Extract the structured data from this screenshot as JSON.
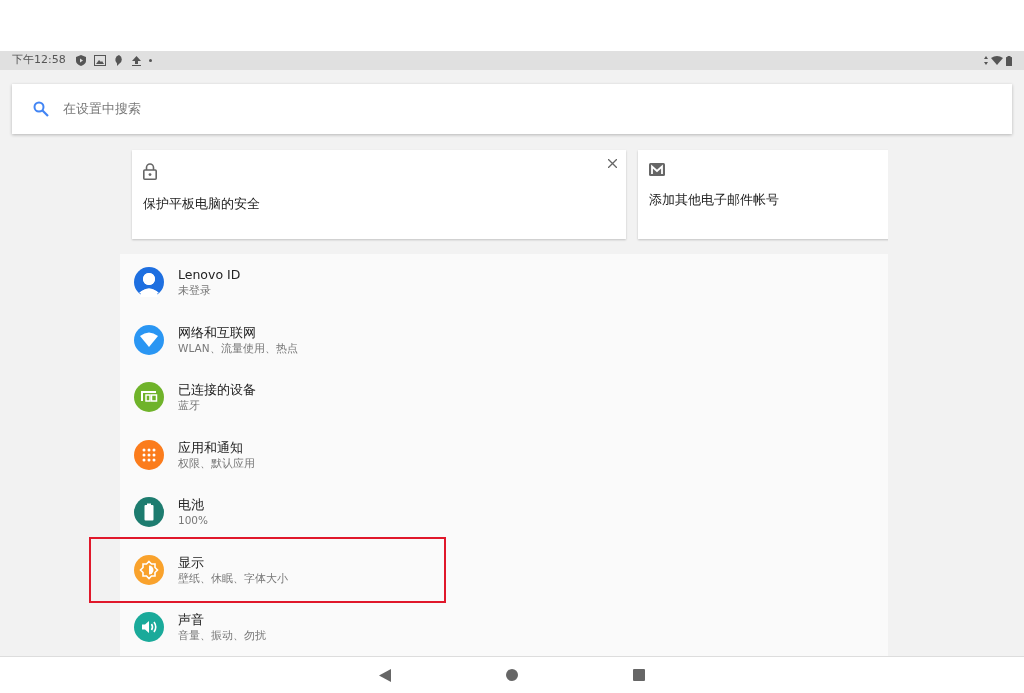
{
  "status_bar": {
    "time": "下午12:58"
  },
  "search": {
    "placeholder": "在设置中搜索"
  },
  "suggestions": [
    {
      "kind": "security",
      "text": "保护平板电脑的安全",
      "dismissible": true
    },
    {
      "kind": "email",
      "text": "添加其他电子邮件帐号",
      "dismissible": false
    }
  ],
  "settings": [
    {
      "kind": "account",
      "title": "Lenovo ID",
      "subtitle": "未登录",
      "color": "#1e6fe0",
      "highlighted": false
    },
    {
      "kind": "network",
      "title": "网络和互联网",
      "subtitle": "WLAN、流量使用、热点",
      "color": "#2a96f3",
      "highlighted": false
    },
    {
      "kind": "devices",
      "title": "已连接的设备",
      "subtitle": "蓝牙",
      "color": "#6fb32a",
      "highlighted": false
    },
    {
      "kind": "apps",
      "title": "应用和通知",
      "subtitle": "权限、默认应用",
      "color": "#fb7c1c",
      "highlighted": false
    },
    {
      "kind": "battery",
      "title": "电池",
      "subtitle": "100%",
      "color": "#1d7c6f",
      "highlighted": false
    },
    {
      "kind": "display",
      "title": "显示",
      "subtitle": "壁纸、休眠、字体大小",
      "color": "#f9a22c",
      "highlighted": true
    },
    {
      "kind": "sound",
      "title": "声音",
      "subtitle": "音量、振动、勿扰",
      "color": "#1aaa9a",
      "highlighted": false
    }
  ]
}
